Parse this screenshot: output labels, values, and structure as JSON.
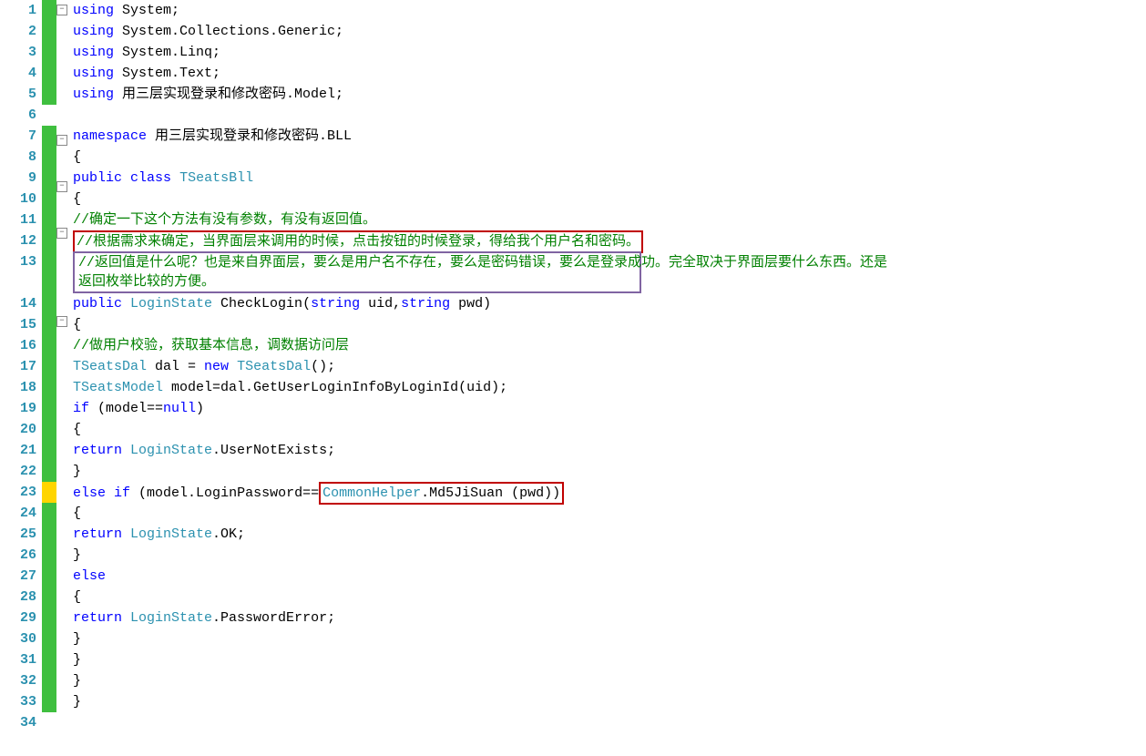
{
  "lines": {
    "1": [
      {
        "c": "kw",
        "t": "using"
      },
      {
        "c": "txt",
        "t": " System;"
      }
    ],
    "2": [
      {
        "c": "kw",
        "t": "using"
      },
      {
        "c": "txt",
        "t": " System.Collections.Generic;"
      }
    ],
    "3": [
      {
        "c": "kw",
        "t": "using"
      },
      {
        "c": "txt",
        "t": " System.Linq;"
      }
    ],
    "4": [
      {
        "c": "kw",
        "t": "using"
      },
      {
        "c": "txt",
        "t": " System.Text;"
      }
    ],
    "5": [
      {
        "c": "kw",
        "t": "using"
      },
      {
        "c": "txt",
        "t": " 用三层实现登录和修改密码.Model;"
      }
    ],
    "6": [],
    "7": [
      {
        "c": "kw",
        "t": "namespace"
      },
      {
        "c": "txt",
        "t": " 用三层实现登录和修改密码.BLL"
      }
    ],
    "8": [
      {
        "c": "txt",
        "t": "{"
      }
    ],
    "9": [
      {
        "c": "txt",
        "t": "    "
      },
      {
        "c": "kw",
        "t": "public"
      },
      {
        "c": "txt",
        "t": " "
      },
      {
        "c": "kw",
        "t": "class"
      },
      {
        "c": "txt",
        "t": " "
      },
      {
        "c": "type",
        "t": "TSeatsBll"
      }
    ],
    "10": [
      {
        "c": "txt",
        "t": "    {"
      }
    ],
    "11": [
      {
        "c": "txt",
        "t": "        "
      },
      {
        "c": "comment",
        "t": "//确定一下这个方法有没有参数，有没有返回值。"
      }
    ],
    "12": [
      {
        "c": "txt",
        "t": "        "
      },
      {
        "c": "comment annot-red",
        "t": "//根据需求来确定，当界面层来调用的时候，点击按钮的时候登录，得给我个用户名和密码。"
      }
    ],
    "13a": [
      {
        "c": "comment",
        "t": "//返回值是什么呢？也是来自界面层，要么是用户名不存在，要么是密码错误，要么是登录成功。完全取决于界面层要什么东西。还是"
      }
    ],
    "13b": [
      {
        "c": "comment",
        "t": "返回枚举比较的方便。"
      }
    ],
    "14": [
      {
        "c": "txt",
        "t": "        "
      },
      {
        "c": "kw",
        "t": "public"
      },
      {
        "c": "txt",
        "t": " "
      },
      {
        "c": "type",
        "t": "LoginState"
      },
      {
        "c": "txt",
        "t": " CheckLogin("
      },
      {
        "c": "kw",
        "t": "string"
      },
      {
        "c": "txt",
        "t": " uid,"
      },
      {
        "c": "kw",
        "t": "string"
      },
      {
        "c": "txt",
        "t": " pwd)"
      }
    ],
    "15": [
      {
        "c": "txt",
        "t": "        {"
      }
    ],
    "16": [
      {
        "c": "txt",
        "t": "            "
      },
      {
        "c": "comment",
        "t": "//做用户校验，获取基本信息，调数据访问层"
      }
    ],
    "17": [
      {
        "c": "txt",
        "t": "            "
      },
      {
        "c": "type",
        "t": "TSeatsDal"
      },
      {
        "c": "txt",
        "t": " dal = "
      },
      {
        "c": "kw",
        "t": "new"
      },
      {
        "c": "txt",
        "t": " "
      },
      {
        "c": "type",
        "t": "TSeatsDal"
      },
      {
        "c": "txt",
        "t": "();"
      }
    ],
    "18": [
      {
        "c": "txt",
        "t": "            "
      },
      {
        "c": "type",
        "t": "TSeatsModel"
      },
      {
        "c": "txt",
        "t": " model=dal.GetUserLoginInfoByLoginId(uid);"
      }
    ],
    "19": [
      {
        "c": "txt",
        "t": "            "
      },
      {
        "c": "kw",
        "t": "if"
      },
      {
        "c": "txt",
        "t": " (model=="
      },
      {
        "c": "kw",
        "t": "null"
      },
      {
        "c": "txt",
        "t": ")"
      }
    ],
    "20": [
      {
        "c": "txt",
        "t": "            {"
      }
    ],
    "21": [
      {
        "c": "txt",
        "t": "                "
      },
      {
        "c": "kw",
        "t": "return"
      },
      {
        "c": "txt",
        "t": " "
      },
      {
        "c": "type",
        "t": "LoginState"
      },
      {
        "c": "txt",
        "t": ".UserNotExists;"
      }
    ],
    "22": [
      {
        "c": "txt",
        "t": "            }"
      }
    ],
    "23a": [
      {
        "c": "txt",
        "t": "            "
      },
      {
        "c": "kw",
        "t": "else"
      },
      {
        "c": "txt",
        "t": " "
      },
      {
        "c": "kw",
        "t": "if"
      },
      {
        "c": "txt",
        "t": " (model.LoginPassword=="
      }
    ],
    "23b": [
      {
        "c": "type",
        "t": "CommonHelper"
      },
      {
        "c": "txt",
        "t": ".Md5JiSuan (pwd))"
      }
    ],
    "24": [
      {
        "c": "txt",
        "t": "            {"
      }
    ],
    "25": [
      {
        "c": "txt",
        "t": "                "
      },
      {
        "c": "kw",
        "t": "return"
      },
      {
        "c": "txt",
        "t": " "
      },
      {
        "c": "type",
        "t": "LoginState"
      },
      {
        "c": "txt",
        "t": ".OK;"
      }
    ],
    "26": [
      {
        "c": "txt",
        "t": "            }"
      }
    ],
    "27": [
      {
        "c": "txt",
        "t": "            "
      },
      {
        "c": "kw",
        "t": "else"
      }
    ],
    "28": [
      {
        "c": "txt",
        "t": "            {"
      }
    ],
    "29": [
      {
        "c": "txt",
        "t": "                "
      },
      {
        "c": "kw",
        "t": "return"
      },
      {
        "c": "txt",
        "t": " "
      },
      {
        "c": "type",
        "t": "LoginState"
      },
      {
        "c": "txt",
        "t": ".PasswordError;"
      }
    ],
    "30": [
      {
        "c": "txt",
        "t": "            }"
      }
    ],
    "31": [
      {
        "c": "txt",
        "t": "        }"
      }
    ],
    "32": [
      {
        "c": "txt",
        "t": "    }"
      }
    ],
    "33": [
      {
        "c": "txt",
        "t": "}"
      }
    ],
    "34": []
  },
  "linenumbers": [
    "1",
    "2",
    "3",
    "4",
    "5",
    "6",
    "7",
    "8",
    "9",
    "10",
    "11",
    "12",
    "13",
    "14",
    "15",
    "16",
    "17",
    "18",
    "19",
    "20",
    "21",
    "22",
    "23",
    "24",
    "25",
    "26",
    "27",
    "28",
    "29",
    "30",
    "31",
    "32",
    "33",
    "34"
  ],
  "modmarks": {
    "1": "green",
    "2": "green",
    "3": "green",
    "4": "green",
    "5": "green",
    "7": "green",
    "8": "green",
    "9": "green",
    "10": "green",
    "11": "green",
    "12": "green",
    "13": "green",
    "14": "green",
    "15": "green",
    "16": "green",
    "17": "green",
    "18": "green",
    "19": "green",
    "20": "green",
    "21": "green",
    "22": "green",
    "23": "yellow",
    "24": "green",
    "25": "green",
    "26": "green",
    "27": "green",
    "28": "green",
    "29": "green",
    "30": "green",
    "31": "green",
    "32": "green",
    "33": "green"
  },
  "fold": {
    "1": "-",
    "7": "-",
    "9": "-",
    "11": "-",
    "14": "-"
  }
}
